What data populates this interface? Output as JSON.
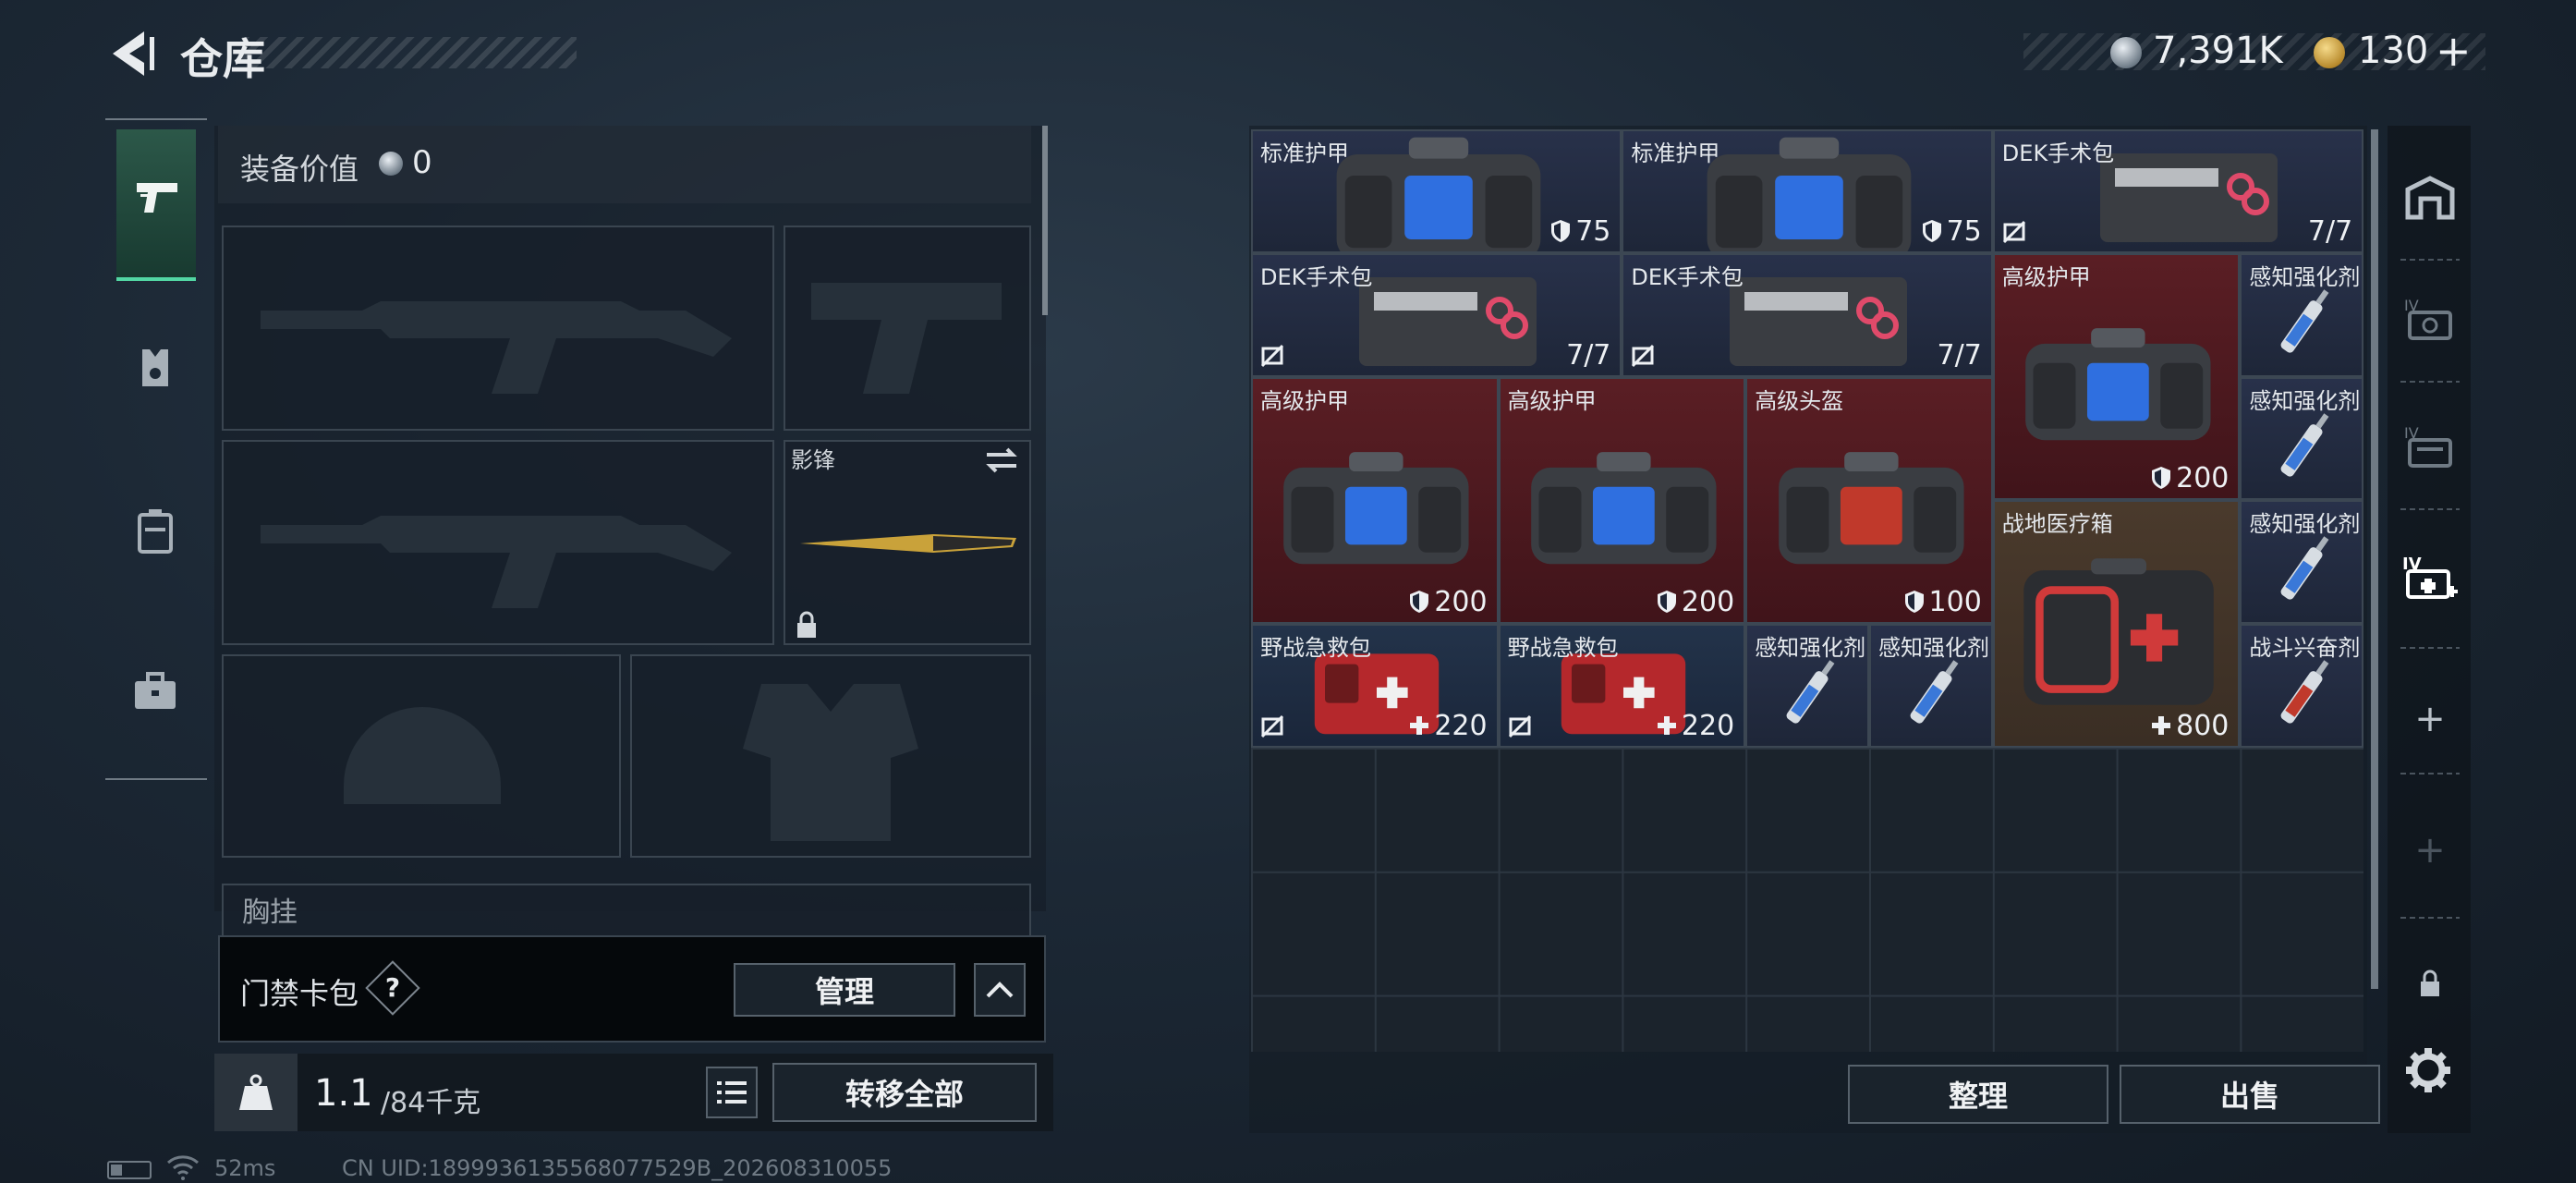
{
  "header": {
    "title": "仓库"
  },
  "currency": {
    "silver": "7,391K",
    "gold": "130"
  },
  "equipment": {
    "value_label": "装备价值",
    "value": "0",
    "knife_name": "影锋",
    "chest_label": "胸挂"
  },
  "keycard": {
    "label": "门禁卡包",
    "help": "?",
    "manage_label": "管理"
  },
  "weight": {
    "current": "1.1",
    "max": "/84千克",
    "transfer_label": "转移全部"
  },
  "status": {
    "ping": "52ms",
    "uid": "CN UID:1899936135568077529В_202608310055"
  },
  "storage": {
    "items": [
      {
        "name": "标准护甲",
        "value": "75",
        "type": "armor"
      },
      {
        "name": "标准护甲",
        "value": "75",
        "type": "armor"
      },
      {
        "name": "DEK手术包",
        "value": "7/7",
        "type": "surgery"
      },
      {
        "name": "DEK手术包",
        "value": "7/7",
        "type": "surgery"
      },
      {
        "name": "DEK手术包",
        "value": "7/7",
        "type": "surgery"
      },
      {
        "name": "高级护甲",
        "value": "200",
        "type": "armor"
      },
      {
        "name": "感知强化剂",
        "value": "",
        "type": "syringe"
      },
      {
        "name": "感知强化剂",
        "value": "",
        "type": "syringe"
      },
      {
        "name": "高级护甲",
        "value": "200",
        "type": "armor"
      },
      {
        "name": "高级护甲",
        "value": "200",
        "type": "armor"
      },
      {
        "name": "高级头盔",
        "value": "100",
        "type": "helmet"
      },
      {
        "name": "感知强化剂",
        "value": "",
        "type": "syringe"
      },
      {
        "name": "战地医疗箱",
        "value": "800",
        "type": "medkit"
      },
      {
        "name": "野战急救包",
        "value": "220",
        "type": "firstaid"
      },
      {
        "name": "野战急救包",
        "value": "220",
        "type": "firstaid"
      },
      {
        "name": "感知强化剂",
        "value": "",
        "type": "syringe"
      },
      {
        "name": "感知强化剂",
        "value": "",
        "type": "syringe"
      },
      {
        "name": "战斗兴奋剂",
        "value": "",
        "type": "syringe-red"
      }
    ],
    "sort_label": "整理",
    "sell_label": "出售"
  },
  "colors": {
    "accent_green": "#52d6a3",
    "rarity_red": "#5a1e24",
    "rarity_gold": "#4a3a2c",
    "rarity_purple": "#28314a"
  }
}
